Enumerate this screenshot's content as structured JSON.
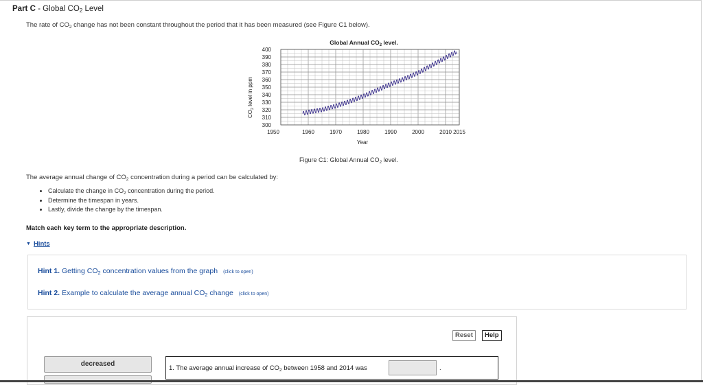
{
  "part": {
    "label": "Part C",
    "sep": " - ",
    "title_pre": "Global CO",
    "title_sub": "2",
    "title_post": " Level"
  },
  "intro": {
    "pre": "The rate of CO",
    "sub": "2",
    "post": " change has not been constant throughout the period that it has been measured (see Figure C1 below)."
  },
  "chart_data": {
    "type": "line",
    "title_pre": "Global Annual CO",
    "title_sub": "2",
    "title_post": " level.",
    "ylabel_pre": "CO",
    "ylabel_sub": "2",
    "ylabel_post": " level in ppm",
    "xlabel": "Year",
    "x_ticks": [
      "1950",
      "1960",
      "1970",
      "1980",
      "1990",
      "2000",
      "2010",
      "2015"
    ],
    "y_ticks": [
      "400",
      "390",
      "380",
      "370",
      "360",
      "350",
      "340",
      "330",
      "320",
      "310",
      "300"
    ],
    "xlim": [
      1950,
      2015
    ],
    "ylim": [
      300,
      400
    ],
    "grid": true,
    "series": [
      {
        "color": "#3a2f8c",
        "x": [
          1958,
          1960,
          1965,
          1970,
          1975,
          1980,
          1985,
          1990,
          1995,
          2000,
          2005,
          2010,
          2014
        ],
        "y": [
          315,
          317,
          320,
          325,
          331,
          338,
          346,
          354,
          361,
          369,
          379,
          389,
          397
        ],
        "seasonal_amplitude": 3
      }
    ]
  },
  "figure_caption": {
    "pre": "Figure C1: Global Annual CO",
    "sub": "2",
    "post": " level."
  },
  "avg": {
    "pre": "The average annual change of CO",
    "sub": "2",
    "post": " concentration during a period can be calculated by:"
  },
  "steps": [
    {
      "pre": "Calculate the change in CO",
      "sub": "2",
      "post": " concentration during the period."
    },
    {
      "pre": "Determine the timespan in years.",
      "sub": "",
      "post": ""
    },
    {
      "pre": "Lastly, divide the change by the timespan.",
      "sub": "",
      "post": ""
    }
  ],
  "match_instruction": "Match each key term to the appropriate description.",
  "hints_label": "Hints",
  "hints": [
    {
      "num": "Hint 1.",
      "pre": " Getting CO",
      "sub": "2",
      "post": " concentration values from the graph",
      "action": "(click to open)"
    },
    {
      "num": "Hint 2.",
      "pre": " Example to calculate the average annual CO",
      "sub": "2",
      "post": " change",
      "action": "(click to open)"
    }
  ],
  "buttons": {
    "reset": "Reset",
    "help": "Help"
  },
  "tiles": [
    "decreased"
  ],
  "statement": {
    "pre": "1. The average annual increase of CO",
    "sub": "2",
    "post": " between 1958 and 2014 was",
    "end": "."
  },
  "colors": {
    "link": "#1a4d9c",
    "series": "#3a2f8c"
  }
}
